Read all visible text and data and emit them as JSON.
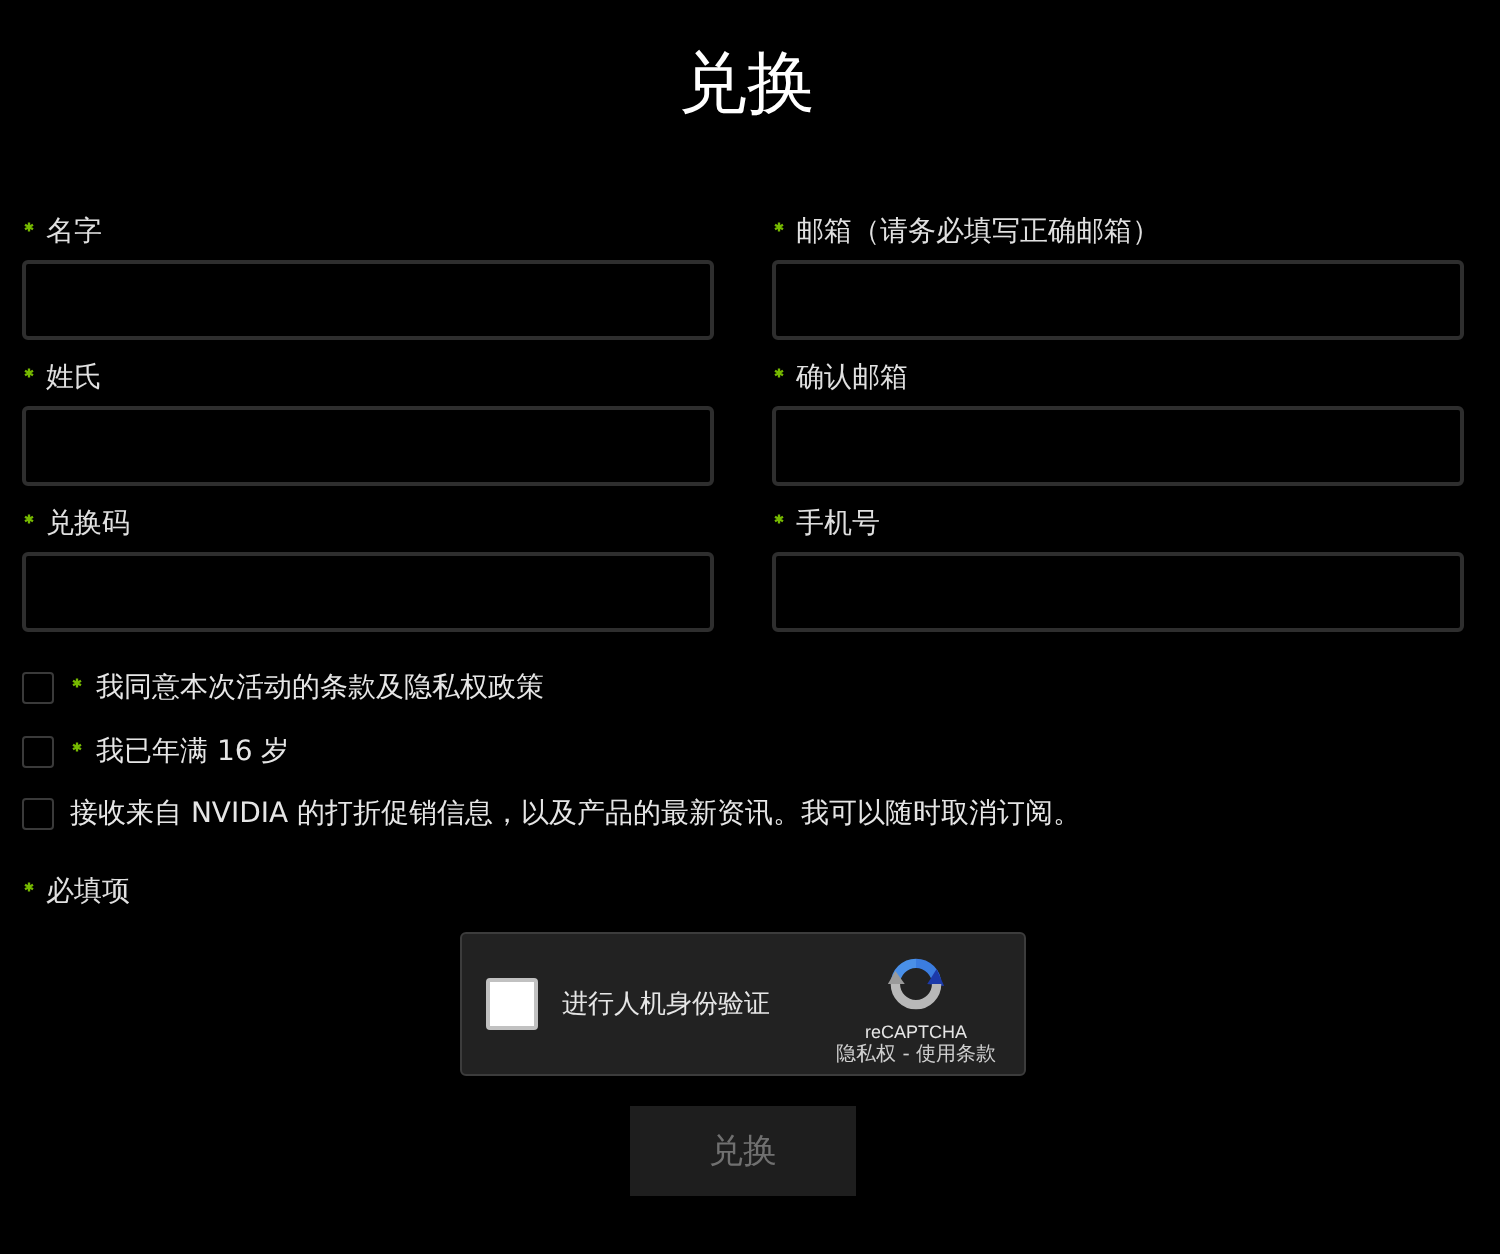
{
  "title": "兑换",
  "fields": [
    {
      "label": "名字",
      "required": true
    },
    {
      "label": "邮箱（请务必填写正确邮箱）",
      "required": true
    },
    {
      "label": "姓氏",
      "required": true
    },
    {
      "label": "确认邮箱",
      "required": true
    },
    {
      "label": "兑换码",
      "required": true
    },
    {
      "label": "手机号",
      "required": true
    }
  ],
  "checkboxes": [
    {
      "label": "我同意本次活动的条款及隐私权政策",
      "required": true,
      "checked": false
    },
    {
      "label": "我已年满 16 岁",
      "required": true,
      "checked": false
    },
    {
      "label": "接收来自 NVIDIA 的打折促销信息，以及产品的最新资讯。我可以随时取消订阅。",
      "required": false,
      "checked": false
    }
  ],
  "required_note": {
    "label": "必填项"
  },
  "captcha": {
    "label": "进行人机身份验证",
    "checked": false,
    "brand": "reCAPTCHA",
    "footer": "隐私权 - 使用条款"
  },
  "submit_button": {
    "label": "兑换",
    "disabled": true
  }
}
